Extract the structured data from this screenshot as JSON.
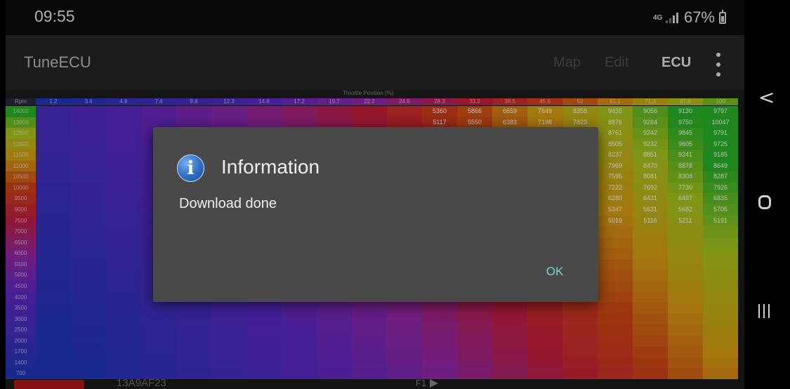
{
  "status_bar": {
    "time": "09:55",
    "network": "4G",
    "battery": "67%"
  },
  "app_bar": {
    "title": "TuneECU",
    "menu": {
      "map": "Map",
      "edit": "Edit",
      "ecu": "ECU"
    }
  },
  "map": {
    "axis_label": "Throttle Position (%)",
    "corner_label": "Rpm",
    "throttle": [
      "1.2",
      "3.4",
      "4.9",
      "7.4",
      "9.8",
      "12.3",
      "14.8",
      "17.2",
      "19.7",
      "22.2",
      "24.6",
      "28.3",
      "33.2",
      "39.5",
      "45.6",
      "52",
      "61.1",
      "71.3",
      "87.6",
      "100"
    ],
    "rpm": [
      "14000",
      "13000",
      "12500",
      "12000",
      "11500",
      "11000",
      "10500",
      "10000",
      "9500",
      "9000",
      "7500",
      "7000",
      "6500",
      "6000",
      "5500",
      "5000",
      "4500",
      "4000",
      "3500",
      "3000",
      "2500",
      "2000",
      "1700",
      "1400",
      "700"
    ],
    "visible_values": {
      "top_right": [
        [
          "5360",
          "5866",
          "6659",
          "7649",
          "8358",
          "9435",
          "9056",
          "9130",
          "9797"
        ],
        [
          "5117",
          "5550",
          "6383",
          "7198",
          "7823",
          "8876",
          "9264",
          "9750",
          "10047"
        ]
      ],
      "right_block": [
        [
          "8761",
          "9242",
          "9845",
          "9791"
        ],
        [
          "8505",
          "9232",
          "9605",
          "9725"
        ],
        [
          "8237",
          "8851",
          "9241",
          "9185"
        ],
        [
          "7969",
          "8470",
          "8878",
          "8649"
        ],
        [
          "7595",
          "8081",
          "8304",
          "8287"
        ],
        [
          "7222",
          "7692",
          "7730",
          "7926"
        ],
        [
          "6280",
          "6431",
          "6497",
          "6835"
        ],
        [
          "5347",
          "5631",
          "5682",
          "5705"
        ],
        [
          "5019",
          "5116",
          "5211",
          "5191"
        ]
      ]
    },
    "file_id": "13A9AF23",
    "page_label": "F1"
  },
  "dialog": {
    "title": "Information",
    "message": "Download done",
    "ok": "OK",
    "icon_glyph": "i"
  },
  "nav": {
    "back_glyph": "<"
  },
  "colors": {
    "dialog_bg": "#494949",
    "ok_accent": "#7fd6cf",
    "appbar_bg": "#262626"
  }
}
